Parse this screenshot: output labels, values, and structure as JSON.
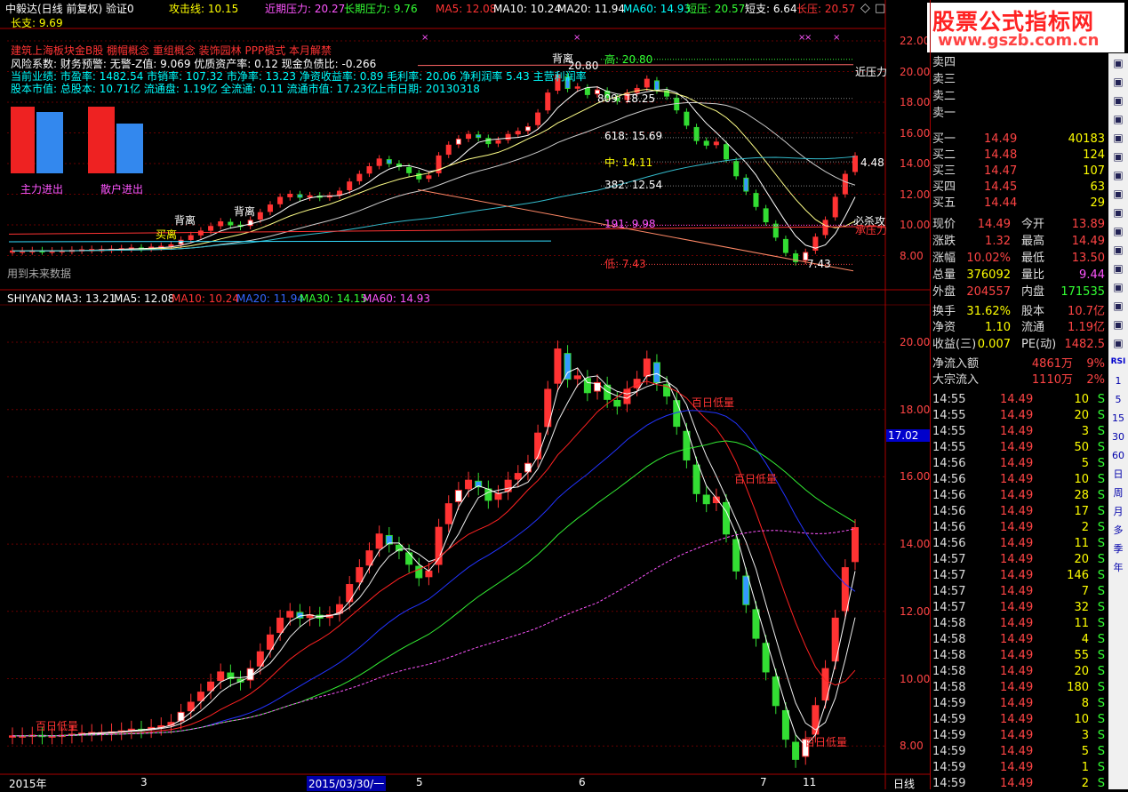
{
  "window": {
    "title": "中毅达(日线 前复权) 验证0",
    "attack_line": "攻击线: 10.15",
    "near_pressure": "近期压力: 20.27",
    "long_pressure": "长期压力: 9.76",
    "ma5": "MA5: 12.08",
    "ma10": "MA10: 10.24",
    "ma20": "MA20: 11.94",
    "ma60": "MA60: 14.93",
    "short_pressure": "短压: 20.57",
    "short_support": "短支: 6.64",
    "long_press2": "长压: 20.57",
    "long_support": "长支: 9.69"
  },
  "logo": {
    "line1": "股票公式指标网",
    "line2": "www.gszb.com.cn"
  },
  "info": {
    "concepts": "建筑上海板块金B股 棚帽概念 重组概念 装饰园林 PPP模式 本月解禁",
    "risk": "风险系数: 财务预警: 无警-Z值: 9.069 优质资产率: 0.12 现金负债比: -0.266",
    "performance": "当前业绩: 市盈率: 1482.54 市销率: 107.32 市净率: 13.23 净资收益率: 0.89 毛利率: 20.06 净利润率 5.43 主营利润率",
    "capital": "股本市值: 总股本: 10.71亿 流通盘: 1.19亿 全流通: 0.11 流通市值: 17.23亿",
    "listing": "上市日期: 20130318",
    "future_data": "用到未来数据"
  },
  "flow_bars": {
    "main": "主力进出",
    "retail": "散户进出"
  },
  "upper_levels": {
    "high": "高: 20.80",
    "l618": "618: 15.69",
    "mid": "中: 14.11",
    "l382": "382: 12.54",
    "l191": "191: 9.98",
    "low": "低: 7.43",
    "l809": "809: 18.25",
    "peak": "20.80",
    "near_press": "近压力",
    "kill": "必杀攻",
    "resist": "承压力",
    "last_price": "4.48",
    "low_mark": "7.43",
    "divergence1": "背离",
    "divergence2": "背离",
    "divergence3": "背离",
    "buy_mark": "买离"
  },
  "upper_axis": [
    "22.00",
    "20.00",
    "18.00",
    "16.00",
    "14.00",
    "12.00",
    "10.00",
    "8.00"
  ],
  "lower_header": {
    "name": "SHIYAN2",
    "ma3": "MA3: 13.21",
    "ma5": "MA5: 12.08",
    "ma10": "MA10: 10.24",
    "ma20": "MA20: 11.94",
    "ma30": "MA30: 14.15",
    "ma60": "MA60: 14.93"
  },
  "lower_axis": [
    "20.00",
    "18.00",
    "16.00",
    "14.00",
    "12.00",
    "10.00",
    "8.00"
  ],
  "lower_marks": {
    "cur_price": "17.02",
    "low1": "百日低量",
    "low2": "百日低量",
    "low3": "百日低量",
    "low4": "百日低量"
  },
  "date_axis": [
    "2015年",
    "3",
    "2015/03/30/一",
    "5",
    "6",
    "7",
    "11"
  ],
  "period_label": "日线",
  "order_book": {
    "sell": [
      {
        "label": "卖四",
        "price": "",
        "vol": ""
      },
      {
        "label": "卖三",
        "price": "",
        "vol": ""
      },
      {
        "label": "卖二",
        "price": "",
        "vol": ""
      },
      {
        "label": "卖一",
        "price": "",
        "vol": ""
      }
    ],
    "buy": [
      {
        "label": "买一",
        "price": "14.49",
        "vol": "40183"
      },
      {
        "label": "买二",
        "price": "14.48",
        "vol": "124"
      },
      {
        "label": "买三",
        "price": "14.47",
        "vol": "107"
      },
      {
        "label": "买四",
        "price": "14.45",
        "vol": "63"
      },
      {
        "label": "买五",
        "price": "14.44",
        "vol": "29"
      }
    ]
  },
  "stats": [
    {
      "l1": "现价",
      "v1": "14.49",
      "l2": "今开",
      "v2": "13.89"
    },
    {
      "l1": "涨跌",
      "v1": "1.32",
      "l2": "最高",
      "v2": "14.49"
    },
    {
      "l1": "涨幅",
      "v1": "10.02%",
      "l2": "最低",
      "v2": "13.50"
    },
    {
      "l1": "总量",
      "v1": "376092",
      "l2": "量比",
      "v2": "9.44"
    },
    {
      "l1": "外盘",
      "v1": "204557",
      "l2": "内盘",
      "v2": "171535"
    },
    {
      "l1": "换手",
      "v1": "31.62%",
      "l2": "股本",
      "v2": "10.7亿"
    },
    {
      "l1": "净资",
      "v1": "1.10",
      "l2": "流通",
      "v2": "1.19亿"
    },
    {
      "l1": "收益(三)",
      "v1": "0.007",
      "l2": "PE(动)",
      "v2": "1482.5"
    }
  ],
  "flows": [
    {
      "label": "净流入额",
      "value": "4861万",
      "pct": "9%"
    },
    {
      "label": "大宗流入",
      "value": "1110万",
      "pct": "2%"
    }
  ],
  "ticks": [
    {
      "t": "14:55",
      "p": "14.49",
      "v": "10",
      "s": "S"
    },
    {
      "t": "14:55",
      "p": "14.49",
      "v": "20",
      "s": "S"
    },
    {
      "t": "14:55",
      "p": "14.49",
      "v": "3",
      "s": "S"
    },
    {
      "t": "14:55",
      "p": "14.49",
      "v": "50",
      "s": "S"
    },
    {
      "t": "14:56",
      "p": "14.49",
      "v": "5",
      "s": "S"
    },
    {
      "t": "14:56",
      "p": "14.49",
      "v": "10",
      "s": "S"
    },
    {
      "t": "14:56",
      "p": "14.49",
      "v": "28",
      "s": "S"
    },
    {
      "t": "14:56",
      "p": "14.49",
      "v": "17",
      "s": "S"
    },
    {
      "t": "14:56",
      "p": "14.49",
      "v": "2",
      "s": "S"
    },
    {
      "t": "14:56",
      "p": "14.49",
      "v": "11",
      "s": "S"
    },
    {
      "t": "14:57",
      "p": "14.49",
      "v": "20",
      "s": "S"
    },
    {
      "t": "14:57",
      "p": "14.49",
      "v": "146",
      "s": "S"
    },
    {
      "t": "14:57",
      "p": "14.49",
      "v": "7",
      "s": "S"
    },
    {
      "t": "14:57",
      "p": "14.49",
      "v": "32",
      "s": "S"
    },
    {
      "t": "14:58",
      "p": "14.49",
      "v": "11",
      "s": "S"
    },
    {
      "t": "14:58",
      "p": "14.49",
      "v": "4",
      "s": "S"
    },
    {
      "t": "14:58",
      "p": "14.49",
      "v": "55",
      "s": "S"
    },
    {
      "t": "14:58",
      "p": "14.49",
      "v": "20",
      "s": "S"
    },
    {
      "t": "14:58",
      "p": "14.49",
      "v": "180",
      "s": "S"
    },
    {
      "t": "14:59",
      "p": "14.49",
      "v": "8",
      "s": "S"
    },
    {
      "t": "14:59",
      "p": "14.49",
      "v": "10",
      "s": "S"
    },
    {
      "t": "14:59",
      "p": "14.49",
      "v": "3",
      "s": "S"
    },
    {
      "t": "14:59",
      "p": "14.49",
      "v": "5",
      "s": "S"
    },
    {
      "t": "14:59",
      "p": "14.49",
      "v": "1",
      "s": "S"
    },
    {
      "t": "14:59",
      "p": "14.49",
      "v": "2",
      "s": "S"
    }
  ],
  "toolbar": [
    "1",
    "5",
    "15",
    "30",
    "60",
    "日",
    "周",
    "月",
    "多",
    "季",
    "年"
  ],
  "toolbar_icons": [
    "RSI"
  ],
  "chart_data": {
    "type": "candlestick",
    "closes": [
      8.3,
      8.3,
      8.32,
      8.3,
      8.3,
      8.32,
      8.35,
      8.38,
      8.4,
      8.4,
      8.42,
      8.45,
      8.5,
      8.48,
      8.55,
      8.6,
      8.7,
      9.0,
      9.3,
      9.6,
      9.9,
      10.2,
      10.0,
      9.9,
      10.3,
      10.8,
      11.3,
      11.8,
      12.0,
      11.8,
      11.9,
      11.8,
      11.9,
      12.2,
      12.8,
      13.3,
      13.8,
      14.3,
      14.0,
      13.8,
      13.4,
      13.0,
      13.2,
      14.5,
      15.2,
      15.6,
      15.9,
      15.7,
      15.3,
      15.5,
      15.9,
      16.1,
      16.4,
      17.3,
      18.6,
      19.8,
      18.9,
      19.0,
      18.5,
      18.8,
      18.3,
      18.1,
      18.6,
      18.9,
      19.5,
      18.8,
      18.4,
      17.5,
      16.5,
      15.5,
      15.2,
      15.4,
      14.3,
      13.2,
      12.2,
      11.2,
      10.2,
      9.2,
      8.2,
      7.6,
      8.2,
      9.2,
      10.3,
      11.8,
      13.3,
      14.49
    ]
  }
}
